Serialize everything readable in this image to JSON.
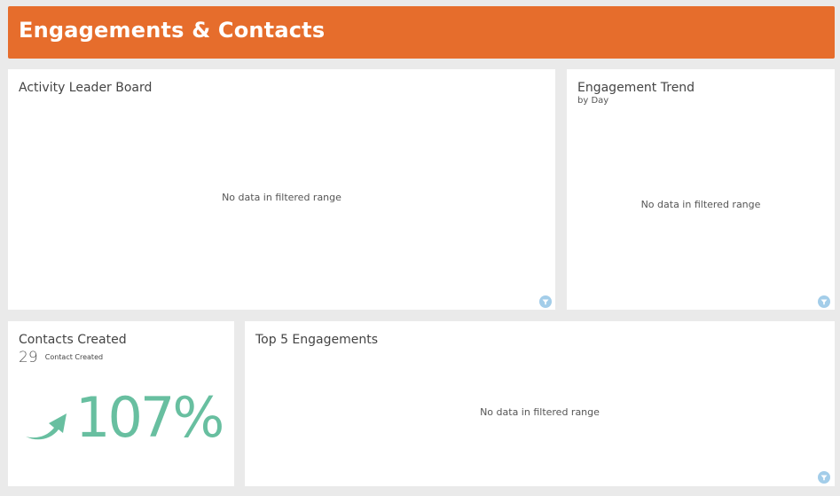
{
  "page": {
    "title": "Engagements & Contacts"
  },
  "widgets": {
    "activity_leader_board": {
      "title": "Activity Leader Board",
      "empty_message": "No data in filtered range",
      "filter_icon": "filter-icon"
    },
    "engagement_trend": {
      "title": "Engagement Trend",
      "subtitle": "by Day",
      "empty_message": "No data in filtered range",
      "filter_icon": "filter-icon"
    },
    "contacts_created": {
      "title": "Contacts Created",
      "count": "29",
      "count_label": "Contact Created",
      "change_percent": "107%",
      "trend_icon": "trend-up-arrow-icon",
      "accent_color": "#68bfa0"
    },
    "top_5_engagements": {
      "title": "Top 5 Engagements",
      "empty_message": "No data in filtered range",
      "filter_icon": "filter-icon"
    }
  },
  "colors": {
    "header_background": "#e66d2c",
    "page_background": "#eaeaea",
    "card_background": "#ffffff",
    "filter_icon": "#a3cde9"
  }
}
